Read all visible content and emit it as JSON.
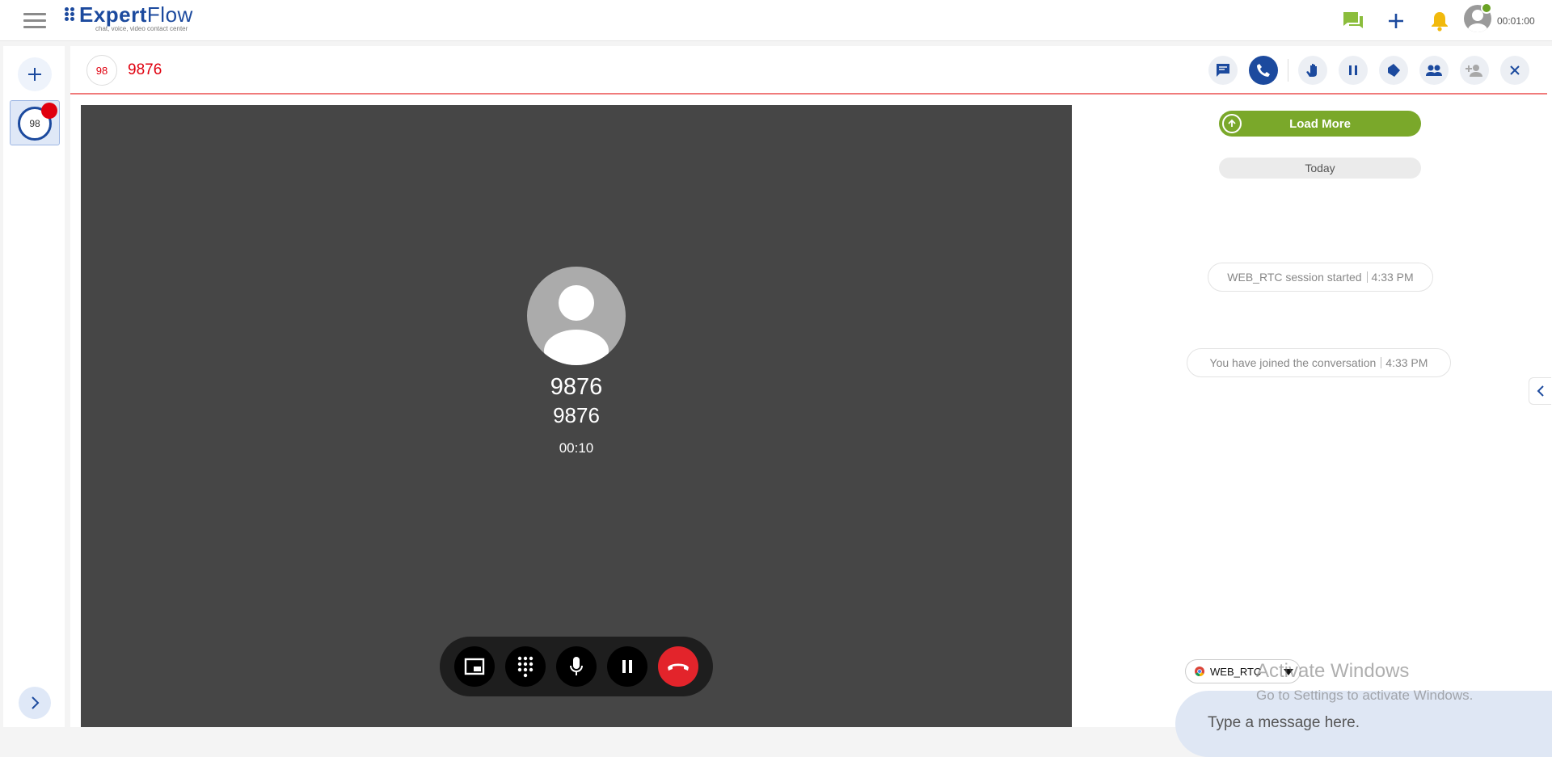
{
  "header": {
    "brand_name_a": "Expert",
    "brand_name_b": "Flow",
    "brand_tagline": "chat, voice, video contact center",
    "agent_timer": "00:01:00",
    "icons": [
      "menu-icon",
      "chat-icon",
      "plus-icon",
      "bell-icon",
      "user-icon"
    ],
    "colors": {
      "brand": "#1c4a9e",
      "status_ready": "#6aa224",
      "bell": "#f1b90c",
      "chat": "#8bbd3c"
    }
  },
  "left_rail": {
    "conversations": [
      {
        "avatar_text": "98",
        "has_notification": true
      }
    ]
  },
  "conversation": {
    "avatar_text": "98",
    "customer_name": "9876",
    "accent_color": "#e0000f"
  },
  "call": {
    "caller_primary": "9876",
    "caller_secondary": "9876",
    "duration": "00:10",
    "controls": [
      "picture-in-picture-icon",
      "dialpad-icon",
      "microphone-icon",
      "pause-icon",
      "end-call-icon"
    ],
    "end_color": "#e3242b"
  },
  "chat": {
    "load_more_label": "Load More",
    "day_label": "Today",
    "messages": [
      {
        "text": "WEB_RTC session started",
        "time": "4:33 PM"
      },
      {
        "text": "You have joined the conversation",
        "time": "4:33 PM"
      }
    ],
    "channel": "WEB_RTC",
    "composer_placeholder": "Type a message here."
  },
  "overlay": {
    "watermark_title": "Activate Windows",
    "watermark_subtitle": "Go to Settings to activate Windows."
  }
}
